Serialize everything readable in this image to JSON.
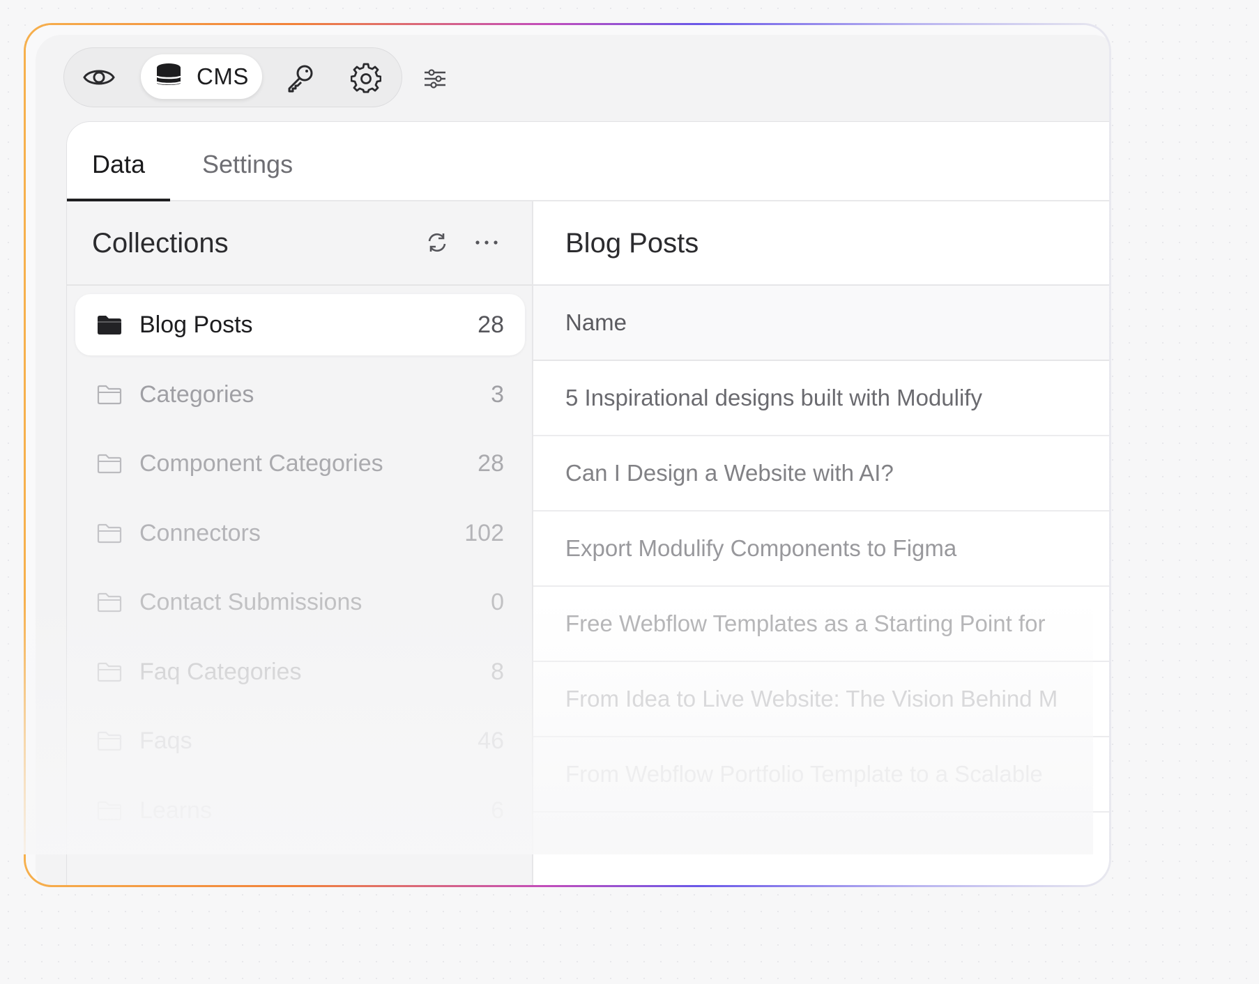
{
  "toolbar": {
    "preview_icon": "eye-icon",
    "cms_label": "CMS",
    "cms_icon": "database-icon",
    "key_icon": "key-icon",
    "settings_icon": "gear-icon",
    "sliders_icon": "sliders-icon"
  },
  "tabs": [
    {
      "label": "Data",
      "active": true
    },
    {
      "label": "Settings",
      "active": false
    }
  ],
  "sidebar": {
    "title": "Collections",
    "refresh_icon": "refresh-icon",
    "more_icon": "more-horizontal-icon",
    "items": [
      {
        "label": "Blog Posts",
        "count": "28",
        "active": true
      },
      {
        "label": "Categories",
        "count": "3"
      },
      {
        "label": "Component Categories",
        "count": "28"
      },
      {
        "label": "Connectors",
        "count": "102"
      },
      {
        "label": "Contact Submissions",
        "count": "0"
      },
      {
        "label": "Faq Categories",
        "count": "8"
      },
      {
        "label": "Faqs",
        "count": "46"
      },
      {
        "label": "Learns",
        "count": "6"
      }
    ]
  },
  "main": {
    "title": "Blog Posts",
    "column": "Name",
    "rows": [
      "5 Inspirational designs built with Modulify",
      "Can I Design a Website with AI?",
      "Export Modulify Components to Figma",
      "Free Webflow Templates as a Starting Point for",
      "From Idea to Live Website: The Vision Behind M",
      "From Webflow Portfolio Template to a Scalable"
    ]
  },
  "colors": {
    "accent_gradient": [
      "#f6b04d",
      "#f2823a",
      "#c24dbb",
      "#6a58e8"
    ],
    "text_primary": "#1d1d1f",
    "text_muted": "#6e6e73"
  }
}
